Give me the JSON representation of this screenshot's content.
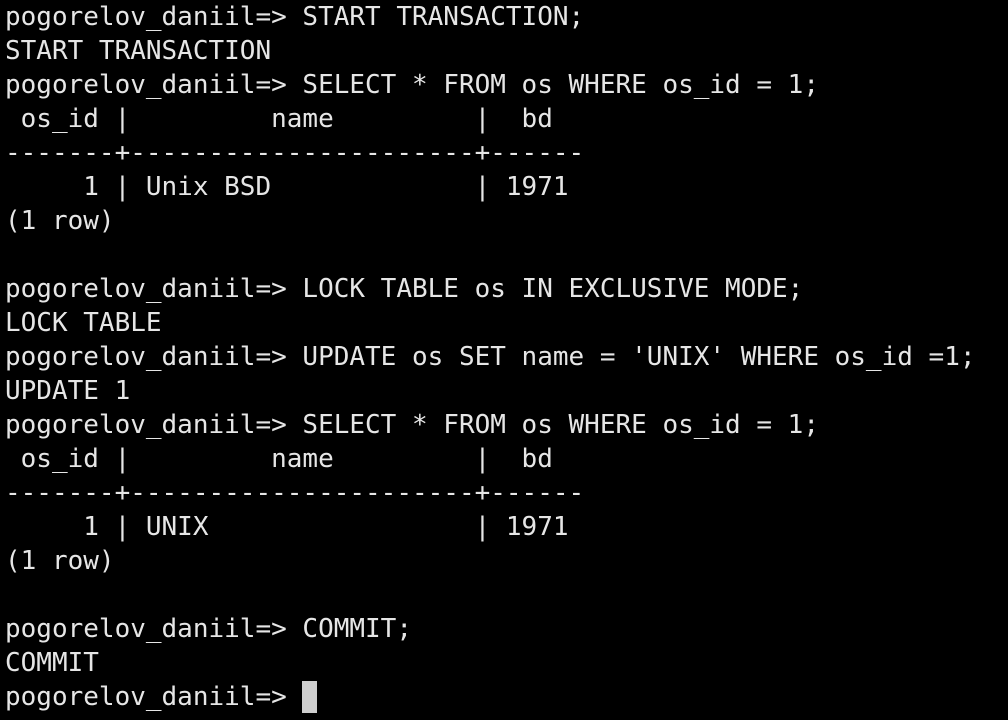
{
  "terminal": {
    "prompt": "pogorelov_daniil=> ",
    "lines": [
      "pogorelov_daniil=> START TRANSACTION;",
      "START TRANSACTION",
      "pogorelov_daniil=> SELECT * FROM os WHERE os_id = 1;",
      " os_id |         name         |  bd",
      "-------+----------------------+------",
      "     1 | Unix BSD             | 1971",
      "(1 row)",
      "",
      "pogorelov_daniil=> LOCK TABLE os IN EXCLUSIVE MODE;",
      "LOCK TABLE",
      "pogorelov_daniil=> UPDATE os SET name = 'UNIX' WHERE os_id =1;",
      "UPDATE 1",
      "pogorelov_daniil=> SELECT * FROM os WHERE os_id = 1;",
      " os_id |         name         |  bd",
      "-------+----------------------+------",
      "     1 | UNIX                 | 1971",
      "(1 row)",
      "",
      "pogorelov_daniil=> COMMIT;",
      "COMMIT"
    ],
    "colors": {
      "background": "#000000",
      "foreground": "#e6e6e6",
      "cursor": "#cfcfcf"
    }
  }
}
